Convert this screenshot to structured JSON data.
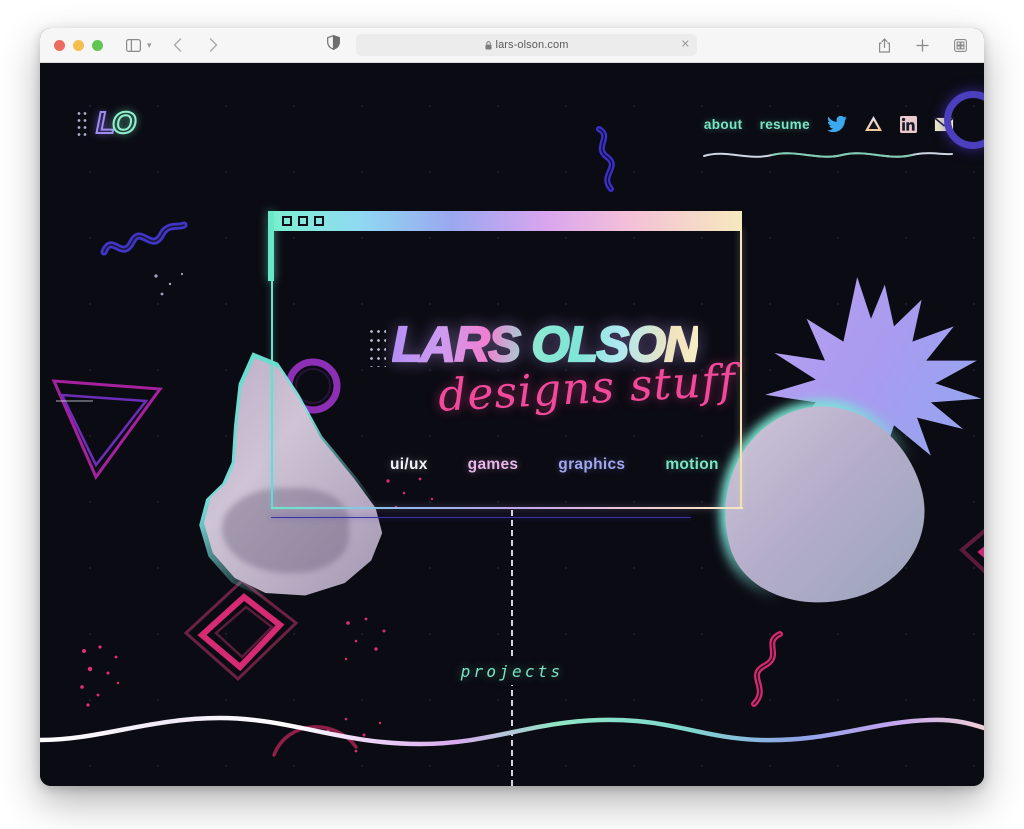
{
  "browser": {
    "traffic_lights": [
      "close",
      "minimize",
      "maximize"
    ],
    "sidebar_label": "sidebar-toggle",
    "back_label": "back",
    "forward_label": "forward",
    "shield_label": "privacy-report",
    "url": "lars-olson.com",
    "lock": "secure-lock-icon",
    "clear_label": "✕",
    "right_icons": [
      "share-icon",
      "new-tab-icon",
      "tab-overview-icon"
    ]
  },
  "site": {
    "logo": {
      "part_1": "L",
      "part_2": "O"
    },
    "nav": {
      "links": [
        {
          "label": "about",
          "name": "nav-link-about"
        },
        {
          "label": "resume",
          "name": "nav-link-resume"
        }
      ],
      "socials": [
        {
          "name": "twitter-icon",
          "label": "Twitter"
        },
        {
          "name": "artstation-icon",
          "label": "ArtStation"
        },
        {
          "name": "linkedin-icon",
          "label": "LinkedIn"
        },
        {
          "name": "email-icon",
          "label": "Email"
        }
      ]
    },
    "hero": {
      "title": "LARS OLSON",
      "subtitle": "designs stuff",
      "window_buttons": 3
    },
    "categories": [
      {
        "label": "ui/ux",
        "color": "#f2f2f8"
      },
      {
        "label": "games",
        "color": "#e8b6e8"
      },
      {
        "label": "graphics",
        "color": "#a0a7f0"
      },
      {
        "label": "motion",
        "color": "#79e6c4"
      }
    ],
    "projects_label": "projects",
    "colors": {
      "background": "#0b0b13",
      "mint": "#79e6c4",
      "pink": "#f2499a",
      "lavender": "#b38ef5",
      "periwinkle": "#a0a7f0",
      "cream": "#f6e9bd",
      "indigo": "#4b3fbe"
    },
    "art": [
      {
        "name": "thumbs-up-halftone",
        "label": "thumbs up hand"
      },
      {
        "name": "pineapple-halftone",
        "label": "pineapple"
      }
    ]
  }
}
